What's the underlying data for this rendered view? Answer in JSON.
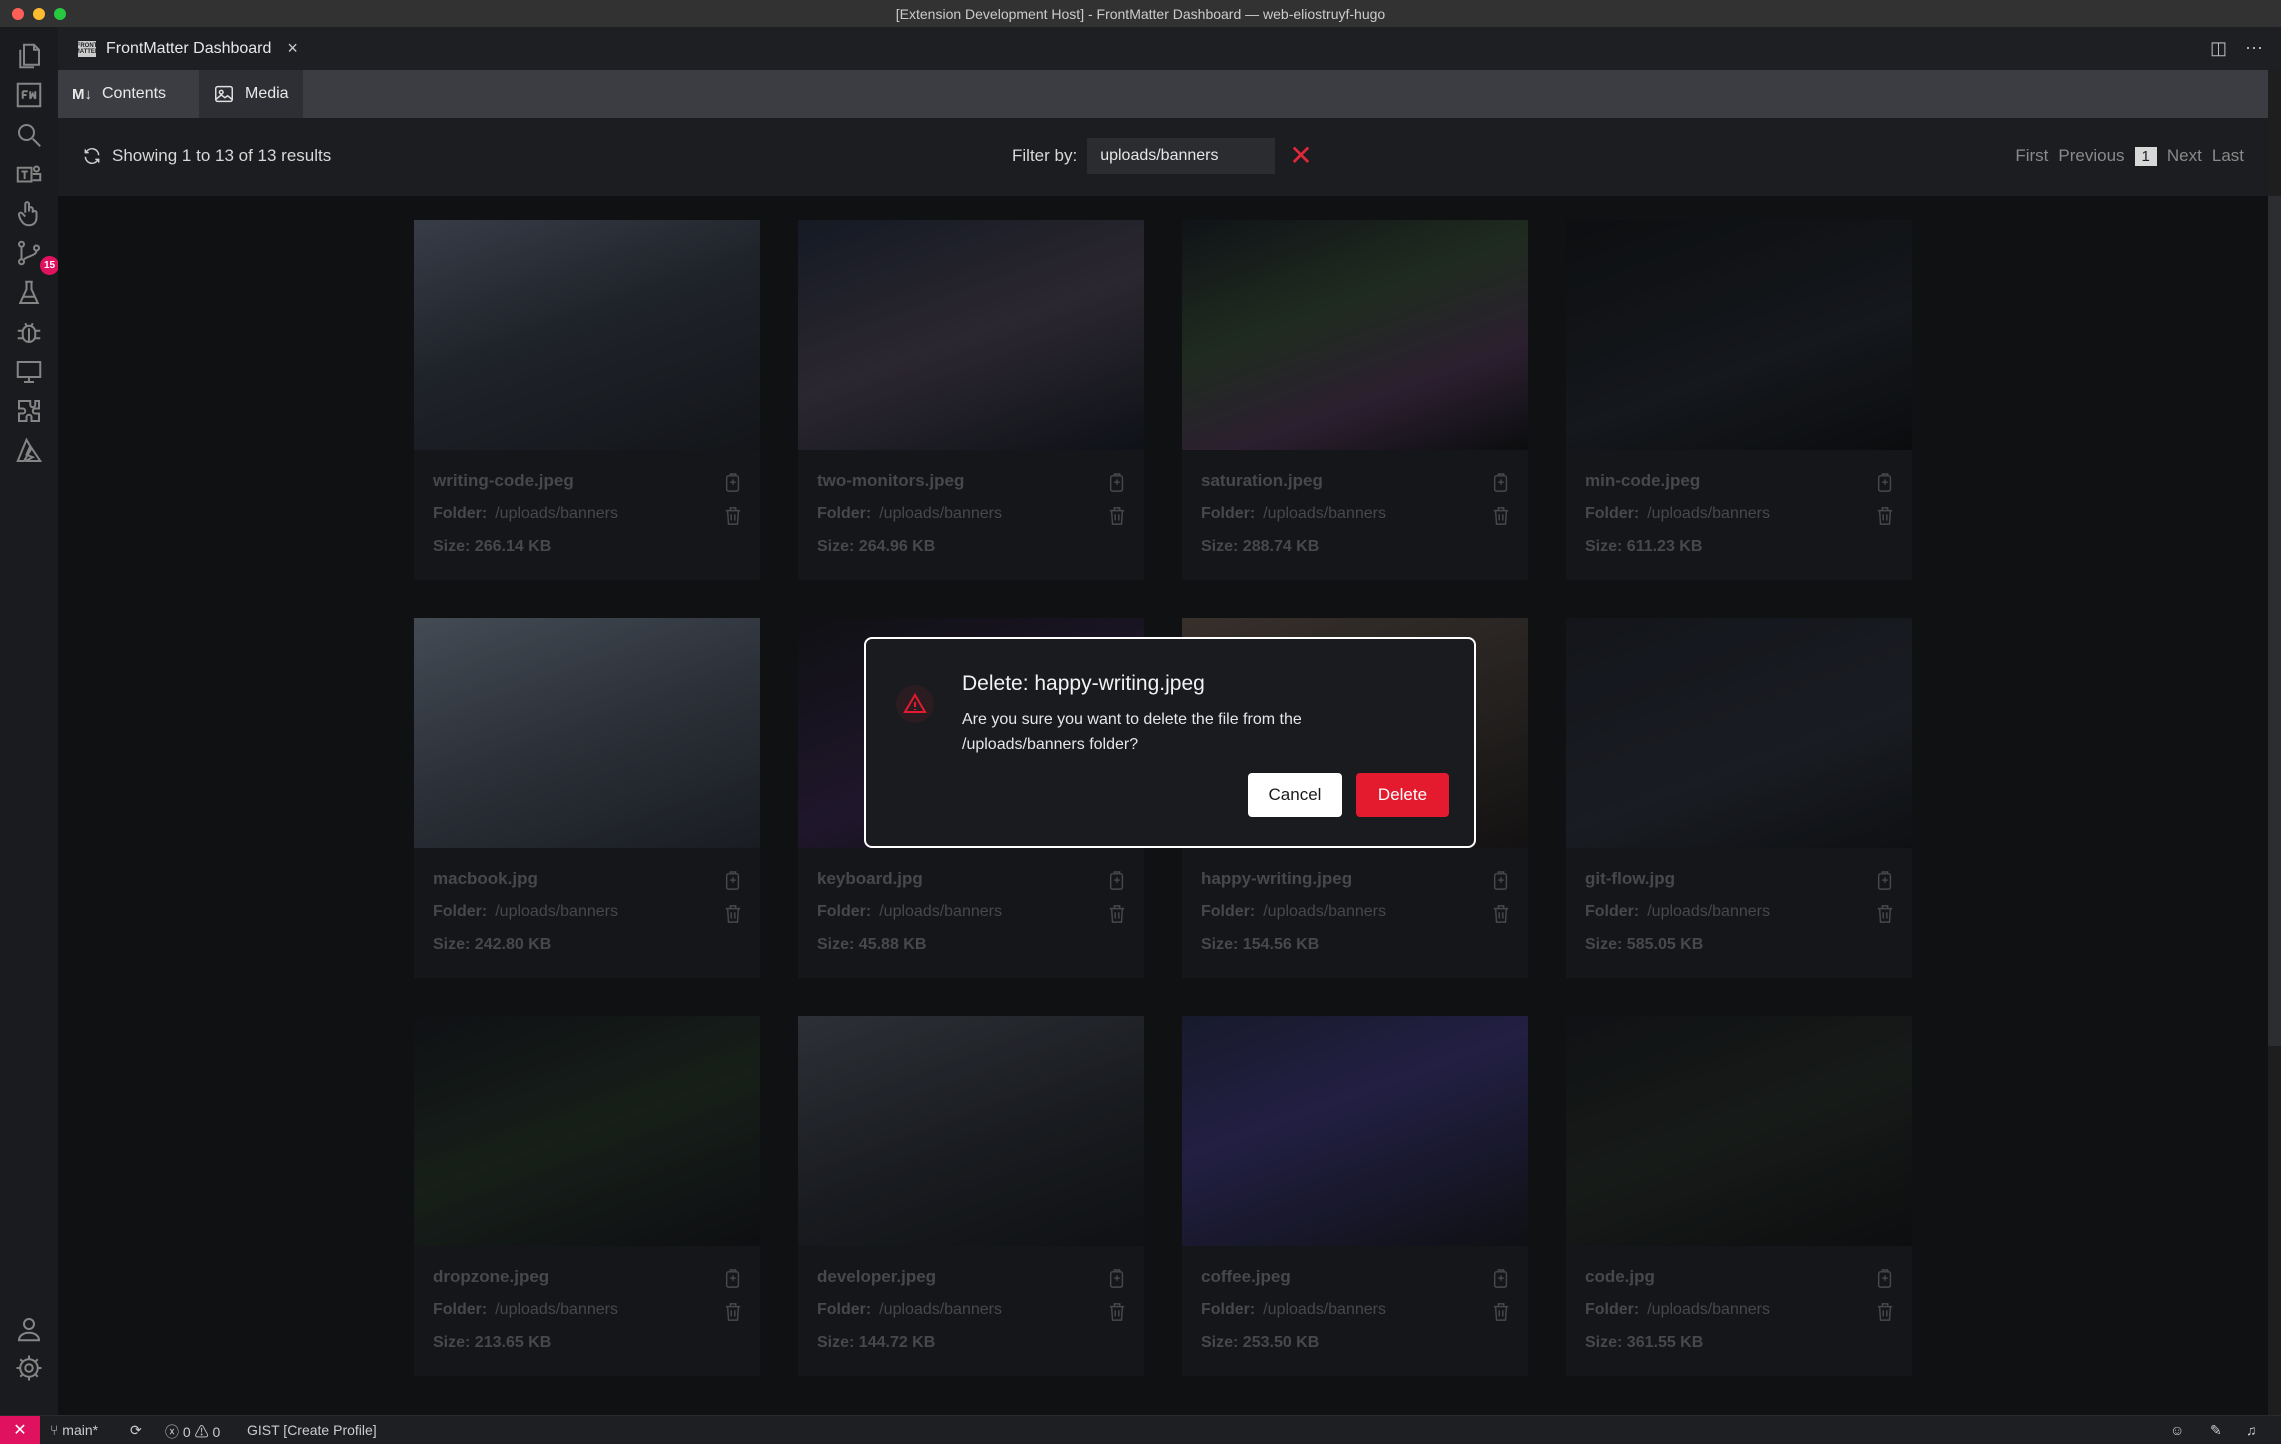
{
  "window": {
    "title": "[Extension Development Host] - FrontMatter Dashboard — web-eliostruyf-hugo"
  },
  "activity_bar": {
    "source_control_badge": "15"
  },
  "tab": {
    "label": "FrontMatter Dashboard",
    "icon_text": "FRONT MATTER"
  },
  "nav": {
    "contents_label": "Contents",
    "contents_icon": "M↓",
    "media_label": "Media"
  },
  "toolbar": {
    "results_text": "Showing 1 to 13 of 13 results",
    "filter_label": "Filter by:",
    "filter_value": "uploads/banners",
    "pager": {
      "first": "First",
      "previous": "Previous",
      "current": "1",
      "next": "Next",
      "last": "Last"
    }
  },
  "media": {
    "folder_label": "Folder:",
    "size_label": "Size:",
    "items": [
      {
        "name": "writing-code.jpeg",
        "folder": "/uploads/banners",
        "size": "266.14 KB"
      },
      {
        "name": "two-monitors.jpeg",
        "folder": "/uploads/banners",
        "size": "264.96 KB"
      },
      {
        "name": "saturation.jpeg",
        "folder": "/uploads/banners",
        "size": "288.74 KB"
      },
      {
        "name": "min-code.jpeg",
        "folder": "/uploads/banners",
        "size": "611.23 KB"
      },
      {
        "name": "macbook.jpg",
        "folder": "/uploads/banners",
        "size": "242.80 KB"
      },
      {
        "name": "keyboard.jpg",
        "folder": "/uploads/banners",
        "size": "45.88 KB"
      },
      {
        "name": "happy-writing.jpeg",
        "folder": "/uploads/banners",
        "size": "154.56 KB"
      },
      {
        "name": "git-flow.jpg",
        "folder": "/uploads/banners",
        "size": "585.05 KB"
      },
      {
        "name": "dropzone.jpeg",
        "folder": "/uploads/banners",
        "size": "213.65 KB"
      },
      {
        "name": "developer.jpeg",
        "folder": "/uploads/banners",
        "size": "144.72 KB"
      },
      {
        "name": "coffee.jpeg",
        "folder": "/uploads/banners",
        "size": "253.50 KB"
      },
      {
        "name": "code.jpg",
        "folder": "/uploads/banners",
        "size": "361.55 KB"
      }
    ]
  },
  "dialog": {
    "title": "Delete: happy-writing.jpeg",
    "message": "Are you sure you want to delete the file from the /uploads/banners folder?",
    "cancel_label": "Cancel",
    "delete_label": "Delete"
  },
  "statusbar": {
    "branch": "main*",
    "errors": "0",
    "warnings": "0",
    "gist": "GIST [Create Profile]"
  },
  "colors": {
    "accent": "#e0115f",
    "danger": "#e41b2e"
  }
}
